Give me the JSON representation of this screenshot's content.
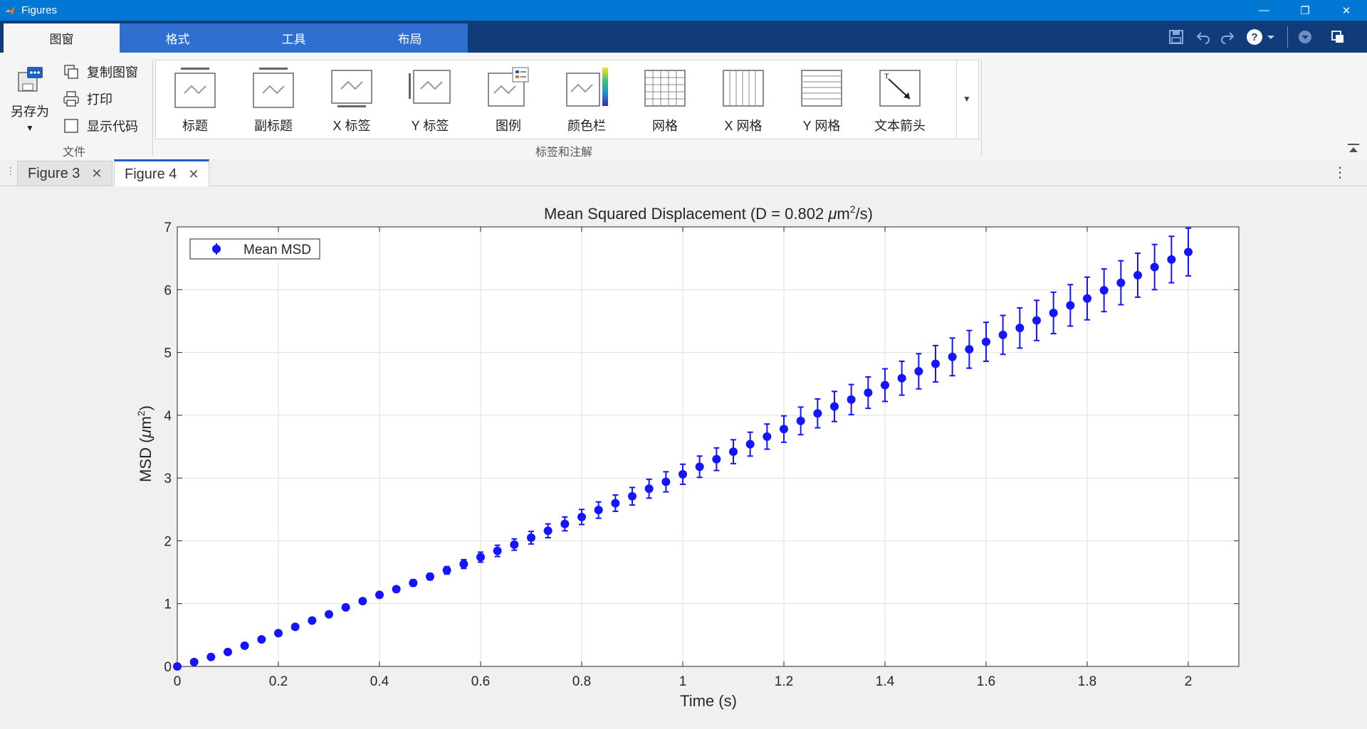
{
  "window": {
    "title": "Figures"
  },
  "ribbon_tabs": [
    "图窗",
    "格式",
    "工具",
    "布局"
  ],
  "file_group": {
    "save_as": "另存为",
    "copy_figure": "复制图窗",
    "print": "打印",
    "show_code": "显示代码",
    "label": "文件"
  },
  "annotation_group": {
    "items": [
      "标题",
      "副标题",
      "X 标签",
      "Y 标签",
      "图例",
      "颜色栏",
      "网格",
      "X 网格",
      "Y 网格",
      "文本箭头"
    ],
    "label": "标签和注解"
  },
  "figure_tabs": [
    {
      "label": "Figure 3",
      "active": false
    },
    {
      "label": "Figure 4",
      "active": true
    }
  ],
  "colors": {
    "marker": "#1414ff",
    "titlebar": "#0078d4",
    "tabbar": "#113c7a"
  },
  "chart_data": {
    "type": "scatter",
    "title_main": "Mean  Squared  Displacement  (D  =  0.802  ",
    "title_mu": "μ",
    "title_m": "m",
    "title_sup": "2",
    "title_end": "/s)",
    "xlabel": "Time (s)",
    "ylabel_main": "MSD  (",
    "ylabel_mu": "μ",
    "ylabel_m": "m",
    "ylabel_sup": "2",
    "ylabel_end": ")",
    "xlim": [
      0,
      2.1
    ],
    "ylim": [
      0,
      7
    ],
    "xticks": [
      "0",
      "0.2",
      "0.4",
      "0.6",
      "0.8",
      "1",
      "1.2",
      "1.4",
      "1.6",
      "1.8",
      "2"
    ],
    "yticks": [
      "0",
      "1",
      "2",
      "3",
      "4",
      "5",
      "6",
      "7"
    ],
    "grid": true,
    "legend": {
      "label": "Mean MSD",
      "position": "top-left"
    },
    "series": [
      {
        "name": "Mean MSD",
        "x": [
          0,
          0.0333,
          0.0667,
          0.1,
          0.1333,
          0.1667,
          0.2,
          0.2333,
          0.2667,
          0.3,
          0.3333,
          0.3667,
          0.4,
          0.4333,
          0.4667,
          0.5,
          0.5333,
          0.5667,
          0.6,
          0.6333,
          0.6667,
          0.7,
          0.7333,
          0.7667,
          0.8,
          0.8333,
          0.8667,
          0.9,
          0.9333,
          0.9667,
          1.0,
          1.0333,
          1.0667,
          1.1,
          1.1333,
          1.1667,
          1.2,
          1.2333,
          1.2667,
          1.3,
          1.3333,
          1.3667,
          1.4,
          1.4333,
          1.4667,
          1.5,
          1.5333,
          1.5667,
          1.6,
          1.6333,
          1.6667,
          1.7,
          1.7333,
          1.7667,
          1.8,
          1.8333,
          1.8667,
          1.9,
          1.9333,
          1.9667,
          2.0
        ],
        "y": [
          0.0,
          0.07,
          0.15,
          0.23,
          0.33,
          0.43,
          0.53,
          0.63,
          0.73,
          0.83,
          0.94,
          1.04,
          1.14,
          1.23,
          1.33,
          1.43,
          1.53,
          1.63,
          1.74,
          1.84,
          1.94,
          2.05,
          2.16,
          2.27,
          2.38,
          2.49,
          2.6,
          2.71,
          2.83,
          2.94,
          3.06,
          3.18,
          3.3,
          3.42,
          3.54,
          3.66,
          3.78,
          3.91,
          4.03,
          4.14,
          4.25,
          4.36,
          4.48,
          4.59,
          4.7,
          4.82,
          4.93,
          5.05,
          5.17,
          5.28,
          5.39,
          5.51,
          5.63,
          5.75,
          5.86,
          5.99,
          6.11,
          6.23,
          6.36,
          6.48,
          6.6
        ],
        "err": [
          0.0,
          0.01,
          0.01,
          0.02,
          0.02,
          0.02,
          0.03,
          0.03,
          0.03,
          0.03,
          0.04,
          0.04,
          0.04,
          0.04,
          0.05,
          0.05,
          0.06,
          0.07,
          0.08,
          0.09,
          0.09,
          0.1,
          0.11,
          0.11,
          0.12,
          0.13,
          0.13,
          0.14,
          0.15,
          0.16,
          0.16,
          0.17,
          0.18,
          0.19,
          0.19,
          0.2,
          0.21,
          0.22,
          0.23,
          0.24,
          0.24,
          0.25,
          0.26,
          0.27,
          0.28,
          0.29,
          0.3,
          0.3,
          0.31,
          0.31,
          0.32,
          0.32,
          0.33,
          0.33,
          0.34,
          0.34,
          0.35,
          0.35,
          0.36,
          0.37,
          0.38
        ]
      }
    ]
  }
}
